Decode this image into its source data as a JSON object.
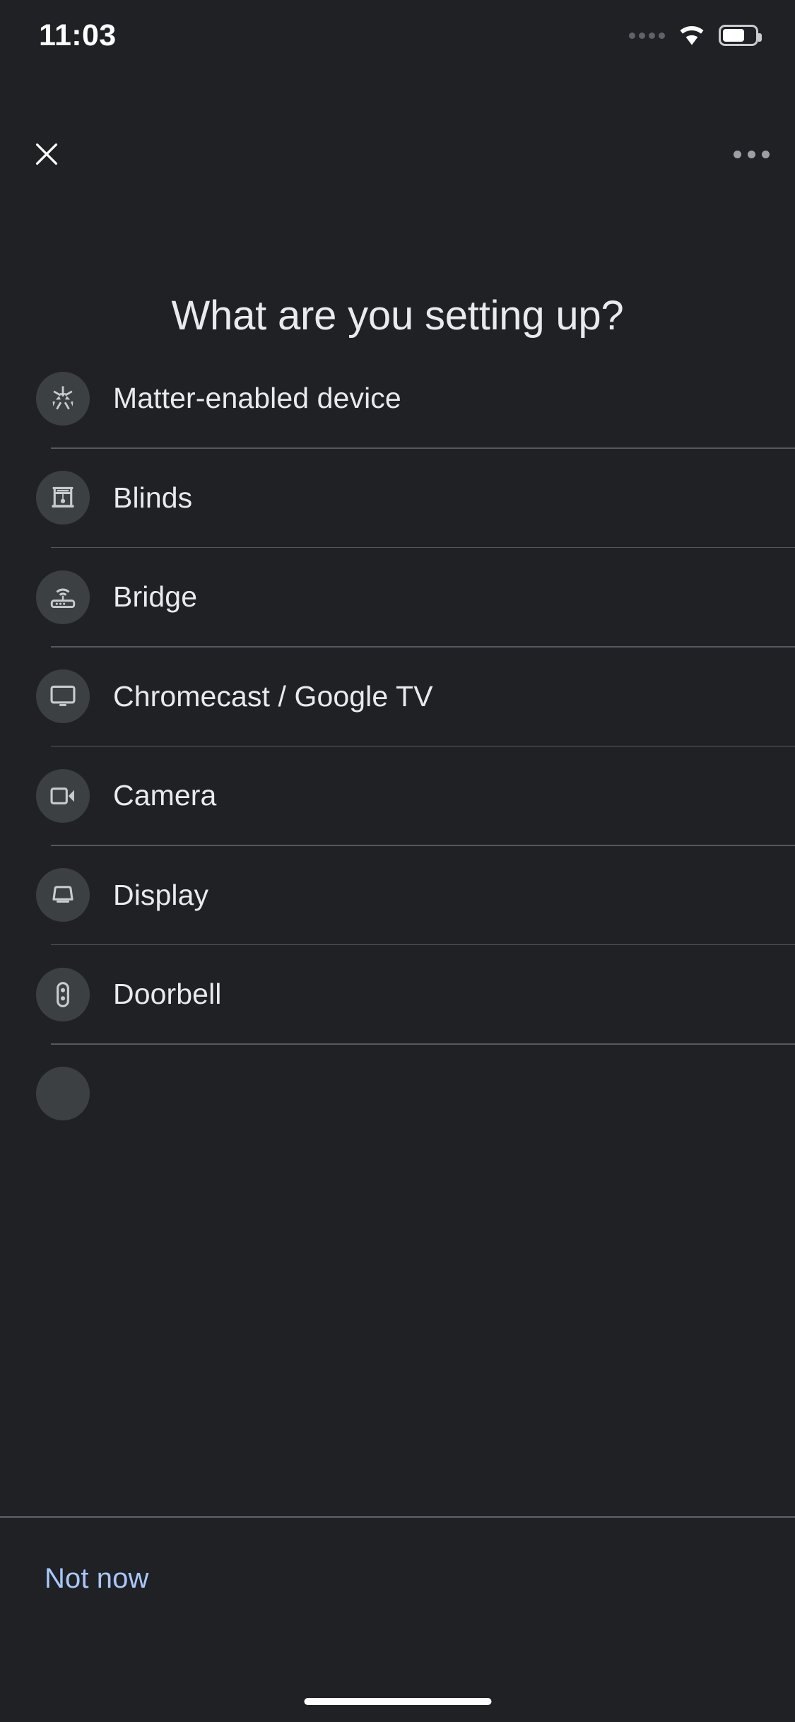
{
  "status_bar": {
    "time": "11:03",
    "signal_icon": "signal-dots-icon",
    "wifi_icon": "wifi-icon",
    "battery_icon": "battery-icon"
  },
  "app_bar": {
    "close_icon": "close-icon",
    "overflow_icon": "overflow-menu-icon"
  },
  "header": {
    "title": "What are you setting up?"
  },
  "colors": {
    "background": "#202124",
    "icon_circle": "#3c4043",
    "primary_text": "#e8eaed",
    "divider": "#5f6368",
    "accent_link": "#a8c7fa",
    "icon_glyph": "#c9ccce"
  },
  "device_list": {
    "items": [
      {
        "label": "Matter-enabled device",
        "icon": "matter-icon"
      },
      {
        "label": "Blinds",
        "icon": "blinds-icon"
      },
      {
        "label": "Bridge",
        "icon": "bridge-router-icon"
      },
      {
        "label": "Chromecast / Google TV",
        "icon": "tv-monitor-icon"
      },
      {
        "label": "Camera",
        "icon": "video-camera-icon"
      },
      {
        "label": "Display",
        "icon": "smart-display-icon"
      },
      {
        "label": "Doorbell",
        "icon": "doorbell-icon"
      },
      {
        "label": "",
        "icon": "partially-visible-icon"
      }
    ]
  },
  "footer": {
    "not_now_label": "Not now"
  }
}
